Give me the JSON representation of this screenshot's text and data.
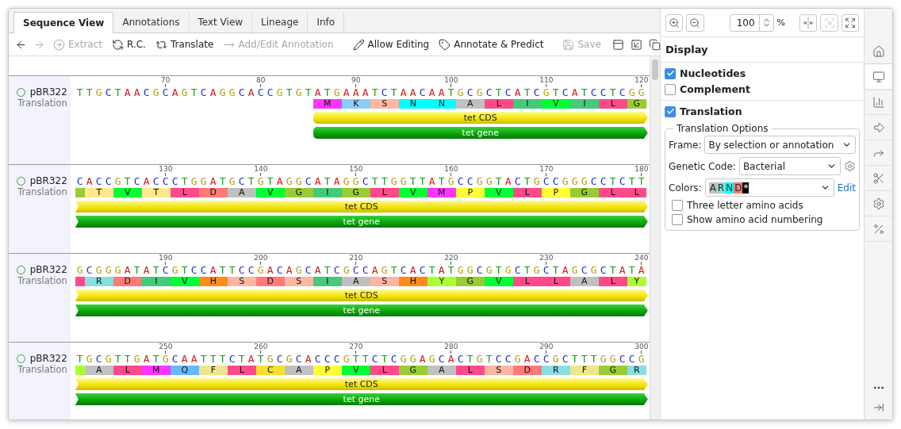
{
  "tabs": [
    {
      "label": "Sequence View",
      "selected": true
    },
    {
      "label": "Annotations",
      "selected": false
    },
    {
      "label": "Text View",
      "selected": false
    },
    {
      "label": "Lineage",
      "selected": false
    },
    {
      "label": "Info",
      "selected": false
    }
  ],
  "toolbar": [
    {
      "kind": "back",
      "disabled": false
    },
    {
      "kind": "forward",
      "disabled": true
    },
    {
      "kind": "extract",
      "label": "Extract",
      "disabled": true
    },
    {
      "kind": "rc",
      "label": "R.C.",
      "disabled": false
    },
    {
      "kind": "translate",
      "label": "Translate",
      "disabled": false
    },
    {
      "kind": "annotate",
      "label": "Add/Edit Annotation",
      "disabled": true
    },
    {
      "kind": "separator"
    },
    {
      "kind": "edit",
      "label": "Allow Editing",
      "disabled": false
    },
    {
      "kind": "predict",
      "label": "Annotate & Predict",
      "disabled": false
    },
    {
      "kind": "separator"
    },
    {
      "kind": "save",
      "label": "Save",
      "disabled": true
    }
  ],
  "sequence_rows": [
    {
      "name": "pBR322",
      "track": "Translation",
      "ruler": [
        "70",
        "80",
        "90",
        "100",
        "110",
        "120"
      ],
      "bases": "TTGCTAACGCAGTCAGGCACCGTGTATGAAATCTAACAATGCGCTCATCGTCATCCTCGG",
      "translation": [
        {
          "kind": "codon",
          "aa": "M",
          "color": "#ff33ff"
        },
        {
          "kind": "codon",
          "aa": "K",
          "color": "#8ccdf5"
        },
        {
          "kind": "codon",
          "aa": "S",
          "color": "#ffb6a1"
        },
        {
          "kind": "codon",
          "aa": "N",
          "color": "#00ffff"
        },
        {
          "kind": "codon",
          "aa": "N",
          "color": "#00ffff"
        },
        {
          "kind": "codon",
          "aa": "A",
          "color": "#c0c0c0"
        },
        {
          "kind": "codon",
          "aa": "L",
          "color": "#ff4a8a"
        },
        {
          "kind": "codon",
          "aa": "I",
          "color": "#45c97a"
        },
        {
          "kind": "codon",
          "aa": "V",
          "color": "#00ff33"
        },
        {
          "kind": "codon",
          "aa": "I",
          "color": "#45c97a"
        },
        {
          "kind": "codon",
          "aa": "L",
          "color": "#ff4a8a"
        },
        {
          "kind": "tail",
          "aa": "G",
          "color": "#99cc33"
        }
      ],
      "features": [
        {
          "kind": "cds",
          "label": "tet CDS",
          "starts_here": true
        },
        {
          "kind": "gene",
          "label": "tet gene",
          "starts_here": true
        }
      ]
    },
    {
      "name": "pBR322",
      "track": "Translation",
      "ruler": [
        "130",
        "140",
        "150",
        "160",
        "170",
        "180"
      ],
      "bases": "CACCGTCACCCTGGATGCTGTAGGCATAGGCTTGGTTATGCCGGTACTGCCGGGCCTCTT",
      "translation": [
        {
          "kind": "head",
          "color": "#99cc33"
        },
        {
          "kind": "codon",
          "aa": "T",
          "color": "#ffe88f"
        },
        {
          "kind": "codon",
          "aa": "V",
          "color": "#00ff33"
        },
        {
          "kind": "codon",
          "aa": "T",
          "color": "#ffe88f"
        },
        {
          "kind": "codon",
          "aa": "L",
          "color": "#ff4a8a"
        },
        {
          "kind": "codon",
          "aa": "D",
          "color": "#ff7a78"
        },
        {
          "kind": "codon",
          "aa": "A",
          "color": "#c0c0c0"
        },
        {
          "kind": "codon",
          "aa": "V",
          "color": "#00ff33"
        },
        {
          "kind": "codon",
          "aa": "G",
          "color": "#99cc33"
        },
        {
          "kind": "codon",
          "aa": "I",
          "color": "#45c97a"
        },
        {
          "kind": "codon",
          "aa": "G",
          "color": "#99cc33"
        },
        {
          "kind": "codon",
          "aa": "L",
          "color": "#ff4a8a"
        },
        {
          "kind": "codon",
          "aa": "V",
          "color": "#00ff33"
        },
        {
          "kind": "codon",
          "aa": "M",
          "color": "#ff33ff"
        },
        {
          "kind": "codon",
          "aa": "P",
          "color": "#ffff33"
        },
        {
          "kind": "codon",
          "aa": "V",
          "color": "#00ff33"
        },
        {
          "kind": "codon",
          "aa": "L",
          "color": "#ff4a8a"
        },
        {
          "kind": "codon",
          "aa": "P",
          "color": "#ffff33"
        },
        {
          "kind": "codon",
          "aa": "G",
          "color": "#99cc33"
        },
        {
          "kind": "codon",
          "aa": "L",
          "color": "#ff4a8a"
        },
        {
          "kind": "tail",
          "aa": "L",
          "color": "#ff4a8a"
        }
      ],
      "features": [
        {
          "kind": "cds",
          "label": "tet CDS",
          "starts_here": false
        },
        {
          "kind": "gene",
          "label": "tet gene",
          "starts_here": false
        }
      ]
    },
    {
      "name": "pBR322",
      "track": "Translation",
      "ruler": [
        "190",
        "200",
        "210",
        "220",
        "230",
        "240"
      ],
      "bases": "GCGGGATATCGTCCATTCCGACAGCATCGCCAGTCACTATGGCGTGCTGCTAGCGCTATA",
      "translation": [
        {
          "kind": "head",
          "color": "#ff4a8a"
        },
        {
          "kind": "codon",
          "aa": "R",
          "color": "#88dfe0"
        },
        {
          "kind": "codon",
          "aa": "D",
          "color": "#ff7a78"
        },
        {
          "kind": "codon",
          "aa": "I",
          "color": "#45c97a"
        },
        {
          "kind": "codon",
          "aa": "V",
          "color": "#00ff33"
        },
        {
          "kind": "codon",
          "aa": "H",
          "color": "#ff8c1a"
        },
        {
          "kind": "codon",
          "aa": "S",
          "color": "#ffb6a1"
        },
        {
          "kind": "codon",
          "aa": "D",
          "color": "#ff7a78"
        },
        {
          "kind": "codon",
          "aa": "S",
          "color": "#ffb6a1"
        },
        {
          "kind": "codon",
          "aa": "I",
          "color": "#45c97a"
        },
        {
          "kind": "codon",
          "aa": "A",
          "color": "#c0c0c0"
        },
        {
          "kind": "codon",
          "aa": "S",
          "color": "#ffb6a1"
        },
        {
          "kind": "codon",
          "aa": "H",
          "color": "#ff8c1a"
        },
        {
          "kind": "codon",
          "aa": "Y",
          "color": "#aaff33"
        },
        {
          "kind": "codon",
          "aa": "G",
          "color": "#99cc33"
        },
        {
          "kind": "codon",
          "aa": "V",
          "color": "#00ff33"
        },
        {
          "kind": "codon",
          "aa": "L",
          "color": "#ff4a8a"
        },
        {
          "kind": "codon",
          "aa": "L",
          "color": "#ff4a8a"
        },
        {
          "kind": "codon",
          "aa": "A",
          "color": "#c0c0c0"
        },
        {
          "kind": "codon",
          "aa": "L",
          "color": "#ff4a8a"
        },
        {
          "kind": "tail",
          "aa": "Y",
          "color": "#aaff33"
        }
      ],
      "features": [
        {
          "kind": "cds",
          "label": "tet CDS",
          "starts_here": false
        },
        {
          "kind": "gene",
          "label": "tet gene",
          "starts_here": false
        }
      ]
    },
    {
      "name": "pBR322",
      "track": "Translation",
      "ruler": [
        "250",
        "260",
        "270",
        "280",
        "290",
        "300"
      ],
      "bases": "TGCGTTGATGCAATTTCTATGCGCACCCGTTCTCGGAGCACTGTCCGACCGCTTTGGCCG",
      "translation": [
        {
          "kind": "head",
          "color": "#aaff33"
        },
        {
          "kind": "codon",
          "aa": "A",
          "color": "#c0c0c0"
        },
        {
          "kind": "codon",
          "aa": "L",
          "color": "#ff4a8a"
        },
        {
          "kind": "codon",
          "aa": "M",
          "color": "#ff33ff"
        },
        {
          "kind": "codon",
          "aa": "Q",
          "color": "#66b8ff"
        },
        {
          "kind": "codon",
          "aa": "F",
          "color": "#f0e68c"
        },
        {
          "kind": "codon",
          "aa": "L",
          "color": "#ff4a8a"
        },
        {
          "kind": "codon",
          "aa": "C",
          "color": "#f5e030"
        },
        {
          "kind": "codon",
          "aa": "A",
          "color": "#c0c0c0"
        },
        {
          "kind": "codon",
          "aa": "P",
          "color": "#ffff33"
        },
        {
          "kind": "codon",
          "aa": "V",
          "color": "#00ff33"
        },
        {
          "kind": "codon",
          "aa": "L",
          "color": "#ff4a8a"
        },
        {
          "kind": "codon",
          "aa": "G",
          "color": "#99cc33"
        },
        {
          "kind": "codon",
          "aa": "A",
          "color": "#c0c0c0"
        },
        {
          "kind": "codon",
          "aa": "L",
          "color": "#ff4a8a"
        },
        {
          "kind": "codon",
          "aa": "S",
          "color": "#ffb6a1"
        },
        {
          "kind": "codon",
          "aa": "D",
          "color": "#ff7a78"
        },
        {
          "kind": "codon",
          "aa": "R",
          "color": "#88dfe0"
        },
        {
          "kind": "codon",
          "aa": "F",
          "color": "#f0e68c"
        },
        {
          "kind": "codon",
          "aa": "G",
          "color": "#99cc33"
        },
        {
          "kind": "tail",
          "aa": "R",
          "color": "#88dfe0"
        }
      ],
      "features": [
        {
          "kind": "cds",
          "label": "tet CDS",
          "starts_here": false
        },
        {
          "kind": "gene",
          "label": "tet gene",
          "starts_here": false
        }
      ]
    }
  ],
  "zoom_buttons": [
    {
      "kind": "zoom-in",
      "disabled": false
    },
    {
      "kind": "zoom-out",
      "disabled": false
    }
  ],
  "zoom": {
    "value": "100",
    "unit": "%"
  },
  "view_buttons": [
    {
      "kind": "fit",
      "disabled": false
    },
    {
      "kind": "find",
      "disabled": true
    },
    {
      "kind": "expand",
      "disabled": false
    }
  ],
  "panel": {
    "title": "Display",
    "options": [
      {
        "label": "Nucleotides",
        "checked": true
      },
      {
        "label": "Complement",
        "checked": false
      }
    ],
    "translation": {
      "label": "Translation",
      "checked": true
    },
    "translation_options": {
      "title": "Translation Options",
      "frame": {
        "label": "Frame:",
        "value": "By selection or annotation"
      },
      "genetic_code": {
        "label": "Genetic Code:",
        "value": "Bacterial"
      },
      "colors": {
        "label": "Colors:",
        "key": [
          {
            "label": "A",
            "color": "#c0c0c0"
          },
          {
            "label": "R",
            "color": "#88dfe0"
          },
          {
            "label": "N",
            "color": "#00ffff"
          },
          {
            "label": "D",
            "color": "#ff7a78"
          },
          {
            "label": "*",
            "color": "#000000"
          }
        ],
        "link": "Edit"
      },
      "checks": [
        {
          "label": "Three letter amino acids",
          "checked": false
        },
        {
          "label": "Show amino acid numbering",
          "checked": false
        }
      ]
    }
  },
  "side_tabs": [
    {
      "kind": "home",
      "selected": false
    },
    {
      "kind": "display",
      "selected": true
    },
    {
      "kind": "stats",
      "selected": false
    },
    {
      "kind": "annotate",
      "selected": false
    },
    {
      "kind": "predict",
      "selected": false
    },
    {
      "kind": "cut",
      "selected": false
    },
    {
      "kind": "settings",
      "selected": false
    },
    {
      "kind": "percent",
      "selected": false
    }
  ]
}
